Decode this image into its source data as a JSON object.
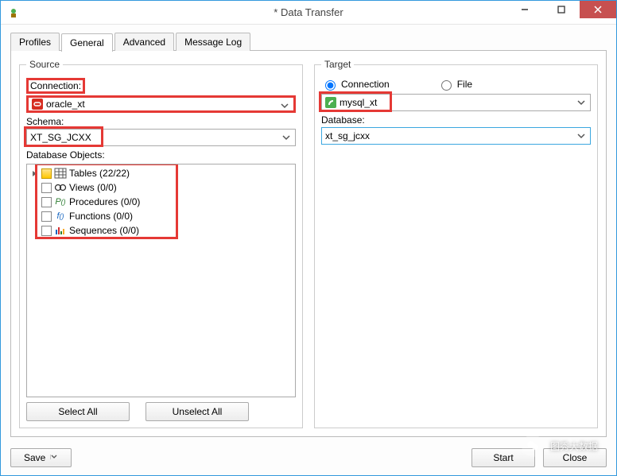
{
  "window": {
    "title": "* Data Transfer"
  },
  "tabs": {
    "profiles": "Profiles",
    "general": "General",
    "advanced": "Advanced",
    "message_log": "Message Log"
  },
  "source": {
    "legend": "Source",
    "connection_label": "Connection:",
    "connection_value": "oracle_xt",
    "schema_label": "Schema:",
    "schema_value": "XT_SG_JCXX",
    "db_objects_label": "Database Objects:",
    "tree": {
      "tables": "Tables  (22/22)",
      "views": "Views  (0/0)",
      "procedures": "Procedures  (0/0)",
      "functions": "Functions  (0/0)",
      "sequences": "Sequences  (0/0)"
    },
    "select_all": "Select All",
    "unselect_all": "Unselect All"
  },
  "target": {
    "legend": "Target",
    "radio_connection": "Connection",
    "radio_file": "File",
    "connection_value": "mysql_xt",
    "database_label": "Database:",
    "database_value": "xt_sg_jcxx"
  },
  "bottom": {
    "save": "Save",
    "start": "Start",
    "close": "Close"
  },
  "watermark": "图秀大数据"
}
